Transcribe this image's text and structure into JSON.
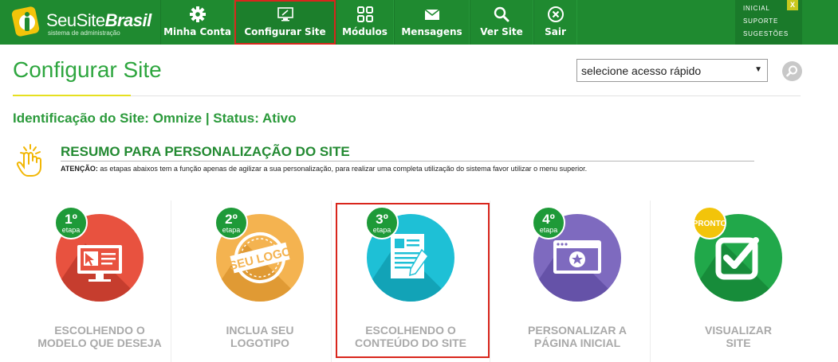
{
  "brand": {
    "name_light": "SeuSite",
    "name_bold": "Brasil",
    "subtitle": "sistema de administração"
  },
  "nav": {
    "items": [
      {
        "label": "Minha Conta",
        "icon": "gear-icon"
      },
      {
        "label": "Configurar Site",
        "icon": "monitor-icon",
        "active": true
      },
      {
        "label": "Módulos",
        "icon": "grid-icon"
      },
      {
        "label": "Mensagens",
        "icon": "envelope-icon"
      },
      {
        "label": "Ver Site",
        "icon": "search-icon"
      },
      {
        "label": "Sair",
        "icon": "close-circle-icon"
      }
    ]
  },
  "quicklinks": {
    "inicial": "INICIAL",
    "suporte": "SUPORTE",
    "sugestoes": "SUGESTÕES",
    "close": "X"
  },
  "page": {
    "title": "Configurar Site"
  },
  "quick_access": {
    "selected": "selecione acesso rápido"
  },
  "site_identification": "Identificação do Site: Omnize | Status: Ativo",
  "resumo": {
    "title": "RESUMO PARA PERSONALIZAÇÃO DO SITE",
    "notice_label": "ATENÇÃO:",
    "notice_text": " as etapas abaixos tem a função apenas de agilizar a sua personalização, para realizar uma completa utilização do sistema favor utilizar o menu superior."
  },
  "steps": [
    {
      "badge": "1º",
      "badge_sub": "etapa",
      "line1": "ESCOLHENDO O",
      "line2": "MODELO QUE DESEJA",
      "color": "#e8523f",
      "icon": "desktop-cursor-icon"
    },
    {
      "badge": "2º",
      "badge_sub": "etapa",
      "line1": "INCLUA SEU",
      "line2": "LOGOTIPO",
      "color": "#f4b350",
      "icon": "seu-logo-stamp-icon",
      "stamp_text": "SEU LOGO"
    },
    {
      "badge": "3º",
      "badge_sub": "etapa",
      "line1": "ESCOLHENDO O",
      "line2": "CONTEÚDO DO SITE",
      "color": "#1ec0d6",
      "icon": "document-pen-icon"
    },
    {
      "badge": "4º",
      "badge_sub": "etapa",
      "line1": "PERSONALIZAR A",
      "line2": "PÁGINA INICIAL",
      "color": "#7e6abf",
      "icon": "browser-star-icon"
    },
    {
      "badge": "PRONTO",
      "badge_sub": "",
      "line1": "VISUALIZAR",
      "line2": "SITE",
      "color": "#21a84a",
      "icon": "checkbox-icon"
    }
  ],
  "colors": {
    "topbar": "#1f8a30",
    "accent_green": "#2ea63f",
    "highlight_red": "#d9261c",
    "badge_green": "#1e9a38",
    "badge_yellow": "#f2c40a"
  }
}
